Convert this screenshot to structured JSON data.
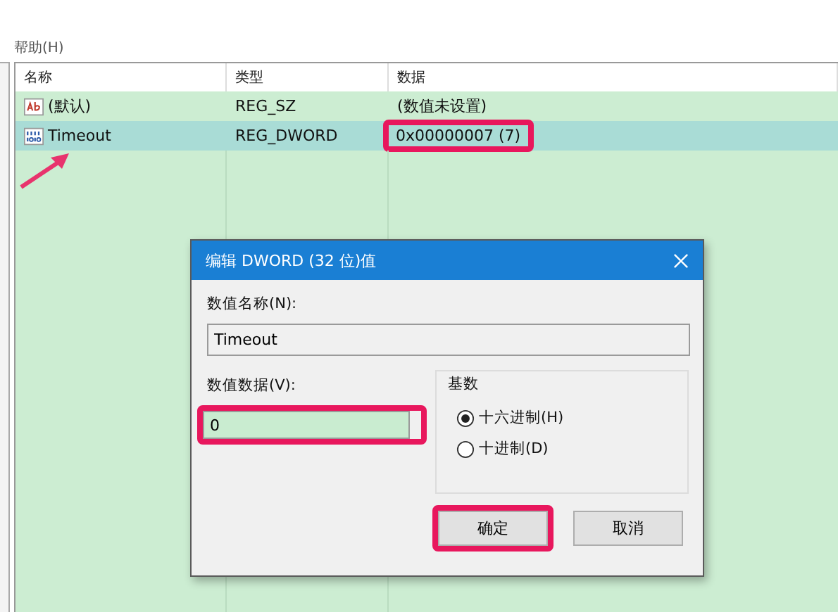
{
  "menu": [
    "帮助(H)"
  ],
  "table": {
    "columns": [
      "名称",
      "类型",
      "数据"
    ],
    "rows": [
      {
        "kind": "string",
        "name": "(默认)",
        "type": "REG_SZ",
        "data": "(数值未设置)",
        "selected": false,
        "highlighted": false
      },
      {
        "kind": "dword",
        "name": "Timeout",
        "type": "REG_DWORD",
        "data": "0x00000007 (7)",
        "selected": true,
        "highlighted": true
      }
    ]
  },
  "dialog": {
    "title": "编辑 DWORD (32 位)值",
    "value_name_label": "数值名称(N):",
    "value_name": "Timeout",
    "value_data_label": "数值数据(V):",
    "value_data": "0",
    "value_data_highlighted": true,
    "base_label": "基数",
    "radios": [
      {
        "label": "十六进制(H)",
        "selected": true
      },
      {
        "label": "十进制(D)",
        "selected": false
      }
    ],
    "buttons": [
      {
        "label": "确定",
        "highlighted": true
      },
      {
        "label": "取消",
        "highlighted": false
      }
    ]
  }
}
